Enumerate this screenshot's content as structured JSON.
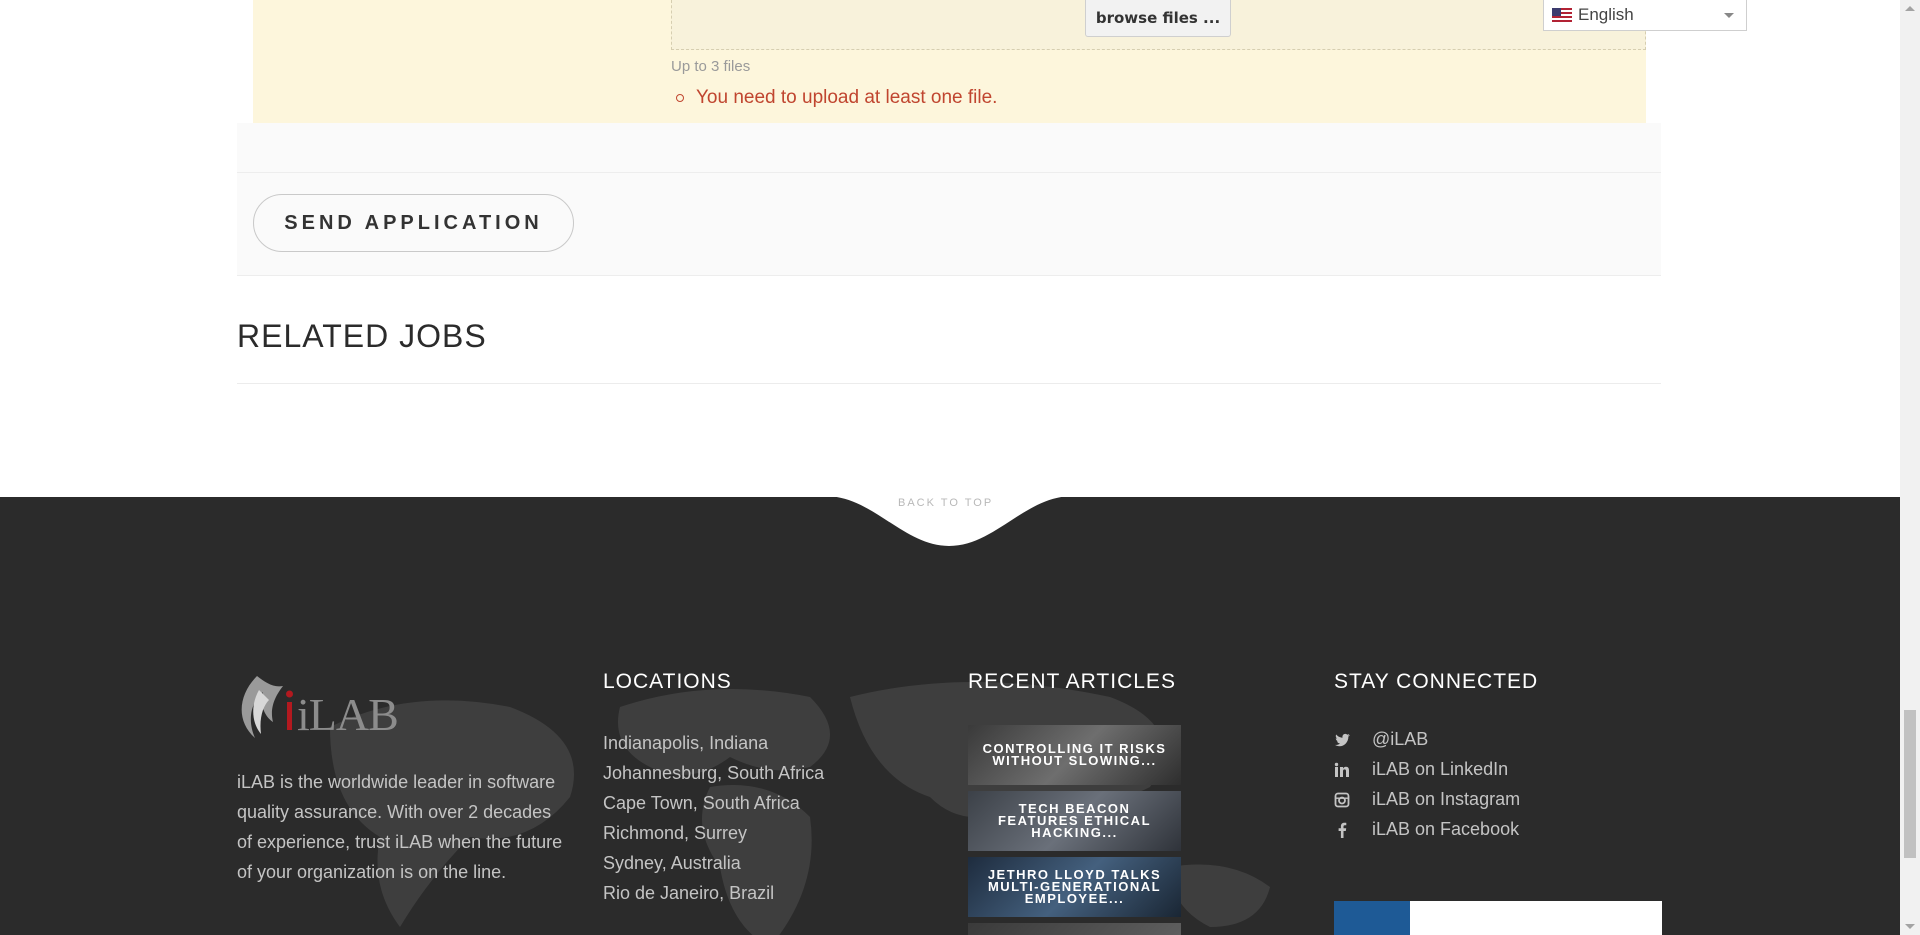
{
  "upload": {
    "browse_label": "browse files ...",
    "hint": "Up to 3 files",
    "error": "You need to upload at least one file."
  },
  "form": {
    "send_label": "SEND APPLICATION"
  },
  "related": {
    "title": "RELATED JOBS"
  },
  "language": {
    "selected": "English"
  },
  "footer": {
    "back_to_top": "BACK TO TOP",
    "about": {
      "logo_text": "iLAB",
      "text": "iLAB is the worldwide leader in software quality assurance. With over 2 decades of experience, trust iLAB when the future of your organization is on the line."
    },
    "locations": {
      "title": "LOCATIONS",
      "items": [
        "Indianapolis, Indiana",
        "Johannesburg, South Africa",
        "Cape Town, South Africa",
        "Richmond, Surrey",
        "Sydney, Australia",
        "Rio de Janeiro, Brazil"
      ]
    },
    "articles": {
      "title": "RECENT ARTICLES",
      "items": [
        "CONTROLLING IT RISKS WITHOUT SLOWING...",
        "TECH BEACON FEATURES ETHICAL HACKING...",
        "JETHRO LLOYD TALKS MULTI-GENERATIONAL EMPLOYEE..."
      ]
    },
    "social": {
      "title": "STAY CONNECTED",
      "items": [
        {
          "icon": "twitter-icon",
          "label": "@iLAB"
        },
        {
          "icon": "linkedin-icon",
          "label": "iLAB on LinkedIn"
        },
        {
          "icon": "instagram-icon",
          "label": "iLAB on Instagram"
        },
        {
          "icon": "facebook-icon",
          "label": "iLAB on Facebook"
        }
      ]
    }
  },
  "colors": {
    "upload_bg": "#fdf6dc",
    "error": "#c0452f",
    "footer_bg": "#2b2b2b",
    "footer_text": "#c4c4c4"
  }
}
